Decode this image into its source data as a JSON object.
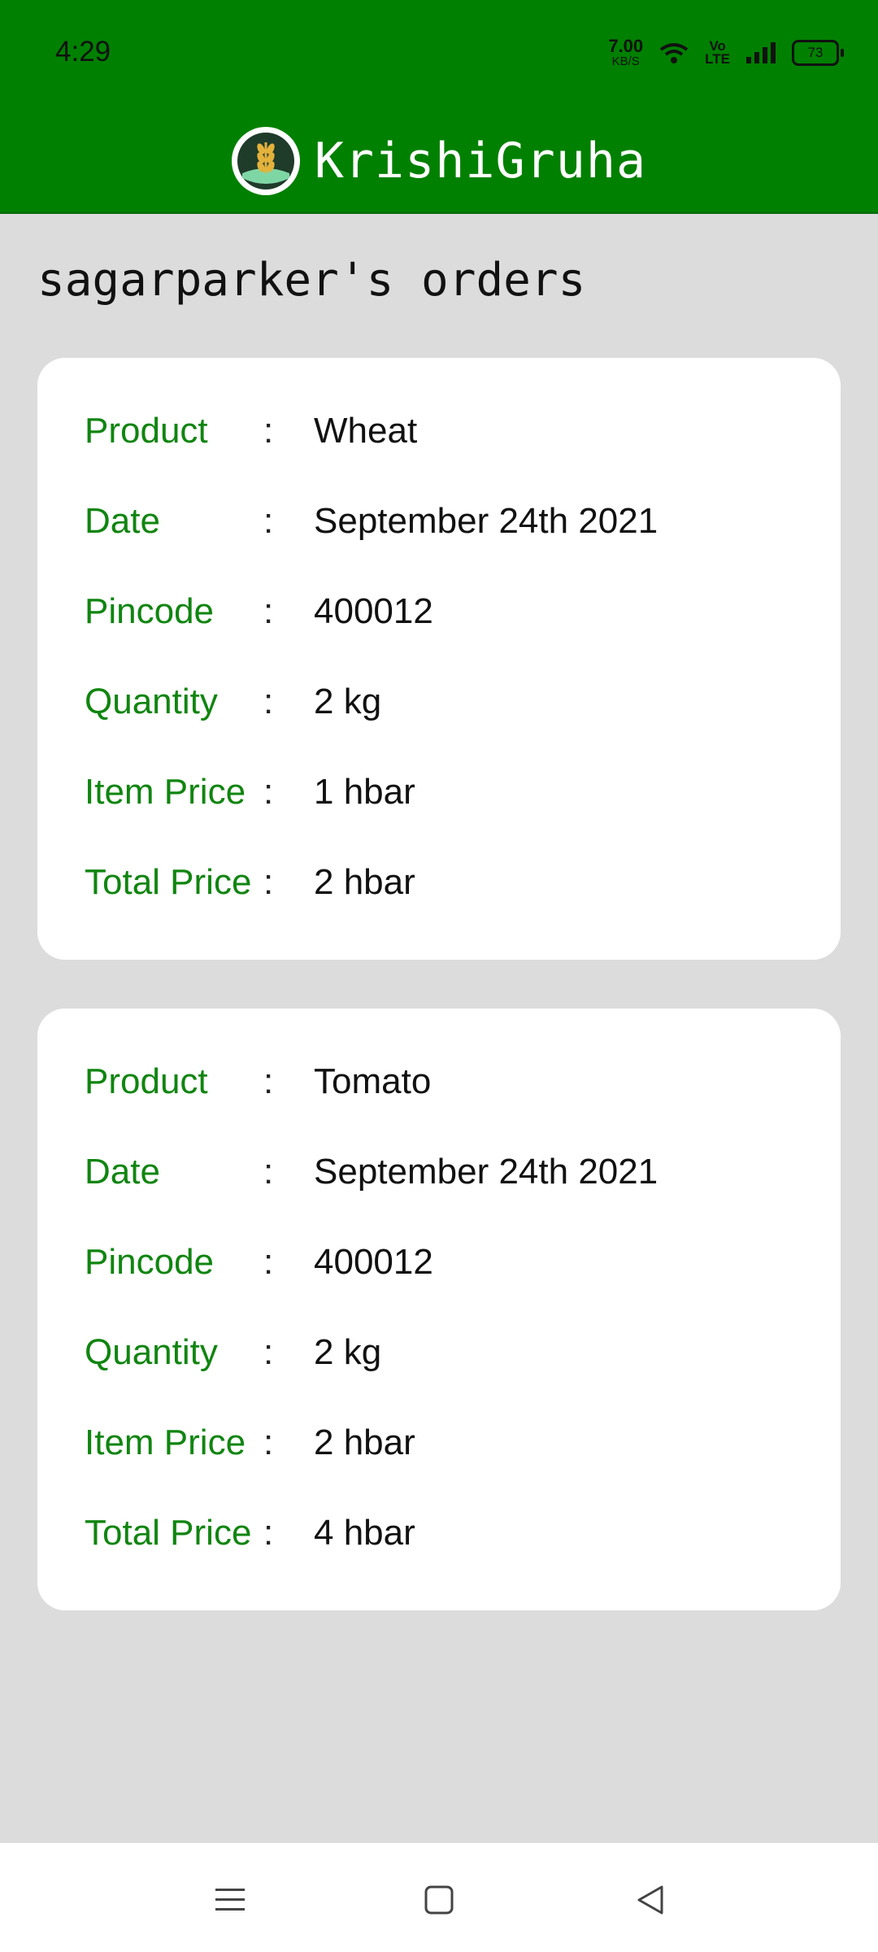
{
  "status_bar": {
    "time": "4:29",
    "network_speed_value": "7.00",
    "network_speed_unit": "KB/S",
    "volte": "Vo\nLTE",
    "battery": "73"
  },
  "header": {
    "app_name": "KrishiGruha"
  },
  "page": {
    "title": "sagarparker's orders"
  },
  "separator": ":",
  "orders": [
    {
      "product_label": "Product",
      "product": "Wheat",
      "date_label": "Date",
      "date": "September 24th 2021",
      "pincode_label": "Pincode",
      "pincode": "400012",
      "quantity_label": "Quantity",
      "quantity": "2 kg",
      "item_price_label": "Item Price",
      "item_price": "1 hbar",
      "total_price_label": "Total Price",
      "total_price": "2 hbar"
    },
    {
      "product_label": "Product",
      "product": "Tomato",
      "date_label": "Date",
      "date": "September 24th 2021",
      "pincode_label": "Pincode",
      "pincode": "400012",
      "quantity_label": "Quantity",
      "quantity": "2 kg",
      "item_price_label": "Item Price",
      "item_price": "2 hbar",
      "total_price_label": "Total Price",
      "total_price": "4 hbar"
    }
  ],
  "colors": {
    "header": "#008000",
    "label": "#108510",
    "background": "#dcdcdc"
  },
  "nav": {
    "icons": [
      "menu-icon",
      "home-square-icon",
      "back-triangle-icon"
    ]
  }
}
